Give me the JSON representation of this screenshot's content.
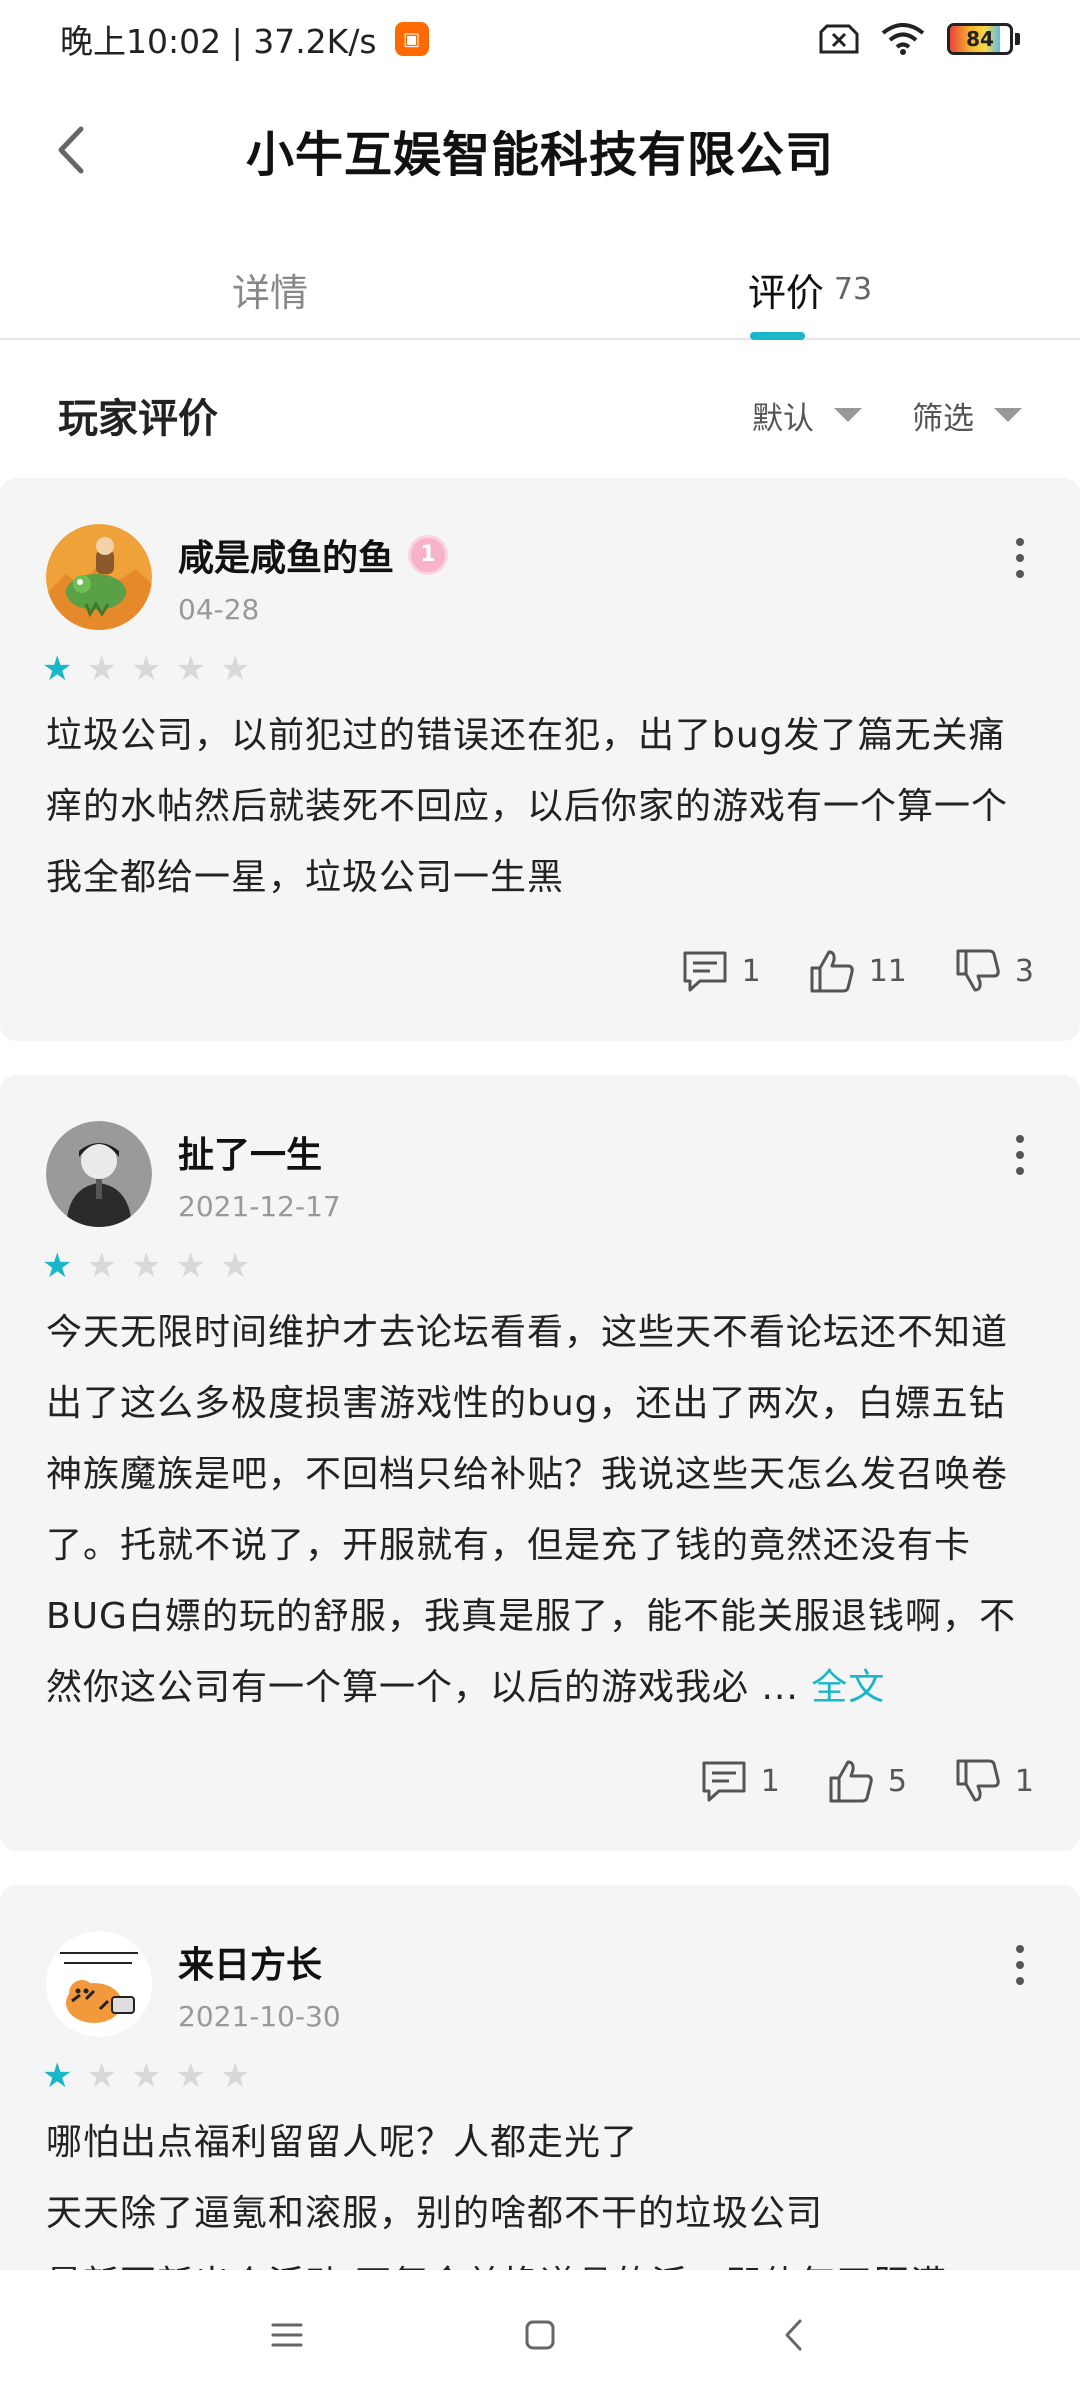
{
  "status_bar": {
    "time_speed": "晚上10:02 | 37.2K/s",
    "battery": "84"
  },
  "header": {
    "title": "小牛互娱智能科技有限公司"
  },
  "tabs": [
    {
      "label": "详情"
    },
    {
      "label": "评价",
      "count": "73"
    }
  ],
  "section": {
    "title": "玩家评价",
    "sort_label": "默认",
    "filter_label": "筛选"
  },
  "reviews": [
    {
      "username": "咸是咸鱼的鱼",
      "badge": "1",
      "date": "04-28",
      "rating": 1,
      "text": "垃圾公司，以前犯过的错误还在犯，出了bug发了篇无关痛痒的水帖然后就装死不回应，以后你家的游戏有一个算一个我全都给一星，垃圾公司一生黑",
      "comments": "1",
      "likes": "11",
      "dislikes": "3"
    },
    {
      "username": "扯了一生",
      "date": "2021-12-17",
      "rating": 1,
      "text": "今天无限时间维护才去论坛看看，这些天不看论坛还不知道出了这么多极度损害游戏性的bug，还出了两次，白嫖五钻神族魔族是吧，不回档只给补贴？我说这些天怎么发召唤卷了。托就不说了，开服就有，但是充了钱的竟然还没有卡BUG白嫖的玩的舒服，我真是服了，能不能关服退钱啊，不然你这公司有一个算一个，以后的游戏我必 ...",
      "read_more": "全文",
      "comments": "1",
      "likes": "5",
      "dislikes": "1"
    },
    {
      "username": "来日方长",
      "date": "2021-10-30",
      "rating": 1,
      "line1": "哪怕出点福利留留人呢？人都走光了",
      "line2": "天天除了逼氪和滚服，别的啥都不干的垃圾公司",
      "line3": "最新更新出个活动:不氪金兑换道具的活，即使每天肝满"
    }
  ]
}
